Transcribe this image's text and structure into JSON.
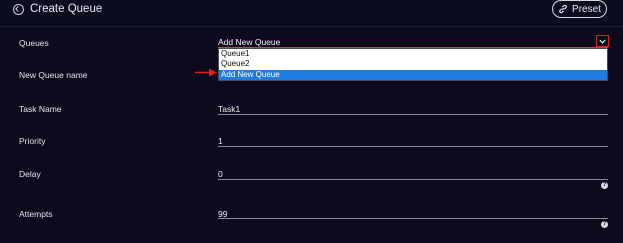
{
  "header": {
    "title": "Create Queue",
    "preset_label": "Preset"
  },
  "form": {
    "queues": {
      "label": "Queues",
      "selected": "Add New Queue",
      "options": [
        "Queue1",
        "Queue2",
        "Add New Queue"
      ]
    },
    "new_queue_name": {
      "label": "New Queue name"
    },
    "task_name": {
      "label": "Task Name",
      "value": "Task1"
    },
    "priority": {
      "label": "Priority",
      "value": "1"
    },
    "delay": {
      "label": "Delay",
      "value": "0",
      "help": "?"
    },
    "attempts": {
      "label": "Attempts",
      "value": "99",
      "help": "?"
    }
  },
  "colors": {
    "background": "#0b0b1d",
    "highlight": "#1e7be0",
    "annotation_red": "#e02020"
  },
  "icons": {
    "header": "back-circle-icon",
    "preset": "link-icon",
    "dropdown": "chevron-down-icon",
    "annotation": "red-arrow-icon",
    "help": "help-icon"
  }
}
